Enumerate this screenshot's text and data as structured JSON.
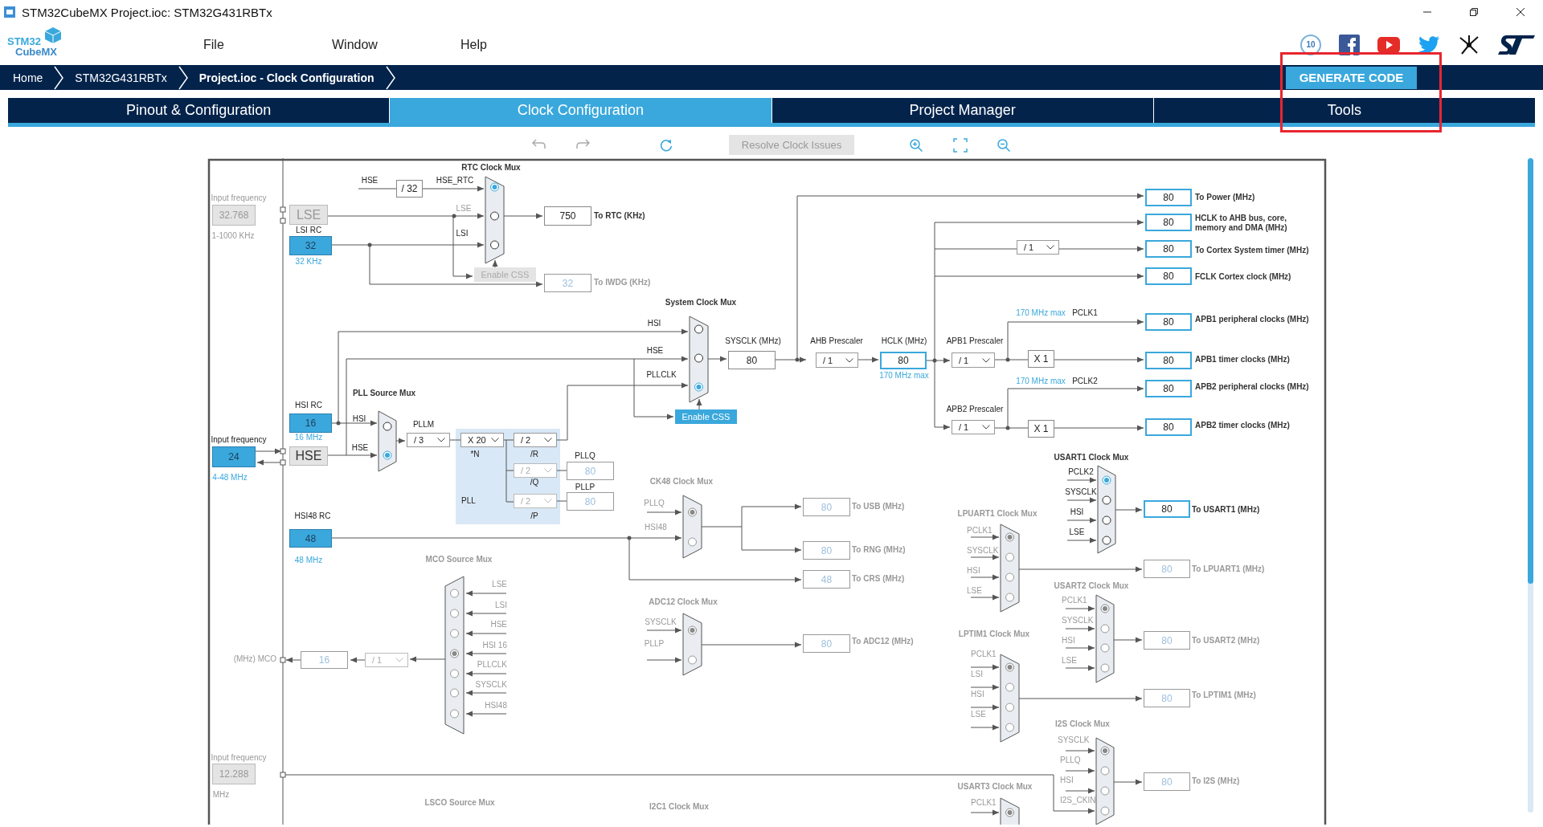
{
  "window": {
    "title": "STM32CubeMX Project.ioc: STM32G431RBTx"
  },
  "app": {
    "logo_top": "STM32",
    "logo_bottom": "CubeMX",
    "menu": [
      "File",
      "Window",
      "Help"
    ],
    "badge": "10"
  },
  "breadcrumbs": [
    {
      "label": "Home",
      "selected": false
    },
    {
      "label": "STM32G431RBTx",
      "selected": false
    },
    {
      "label": "Project.ioc - Clock Configuration",
      "selected": true
    }
  ],
  "generate_button": "GENERATE CODE",
  "tabs": [
    {
      "label": "Pinout & Configuration",
      "selected": false
    },
    {
      "label": "Clock Configuration",
      "selected": true
    },
    {
      "label": "Project Manager",
      "selected": false
    },
    {
      "label": "Tools",
      "selected": false
    }
  ],
  "toolbar": {
    "resolve_button": {
      "label": "Resolve Clock Issues",
      "disabled": true
    }
  },
  "diagram": {
    "labels": [
      {
        "text": "RTC Clock Mux",
        "kind": "title"
      },
      {
        "text": "HSE",
        "kind": "dark"
      },
      {
        "text": "HSE_RTC",
        "kind": "dark"
      },
      {
        "text": "Input frequency",
        "kind": "grey"
      },
      {
        "text": "1-1000 KHz",
        "kind": "grey"
      },
      {
        "text": "LSE",
        "kind": "grey"
      },
      {
        "text": "LSI RC",
        "kind": "dark"
      },
      {
        "text": "LSI",
        "kind": "dark"
      },
      {
        "text": "32 KHz",
        "kind": "blue"
      },
      {
        "text": "To RTC (KHz)",
        "kind": "out"
      },
      {
        "text": "To IWDG (KHz)",
        "kind": "gout"
      },
      {
        "text": "System Clock Mux",
        "kind": "title"
      },
      {
        "text": "HSI",
        "kind": "dark"
      },
      {
        "text": "HSE",
        "kind": "dark"
      },
      {
        "text": "PLLCLK",
        "kind": "dark"
      },
      {
        "text": "SYSCLK (MHz)",
        "kind": "dark"
      },
      {
        "text": "AHB Prescaler",
        "kind": "dark"
      },
      {
        "text": "HCLK (MHz)",
        "kind": "dark"
      },
      {
        "text": "170 MHz max",
        "kind": "blue"
      },
      {
        "text": "APB1 Prescaler",
        "kind": "dark"
      },
      {
        "text": "170 MHz max",
        "kind": "blue"
      },
      {
        "text": "PCLK1",
        "kind": "dark"
      },
      {
        "text": "170 MHz max",
        "kind": "blue"
      },
      {
        "text": "PCLK2",
        "kind": "dark"
      },
      {
        "text": "APB2 Prescaler",
        "kind": "dark"
      },
      {
        "text": "To Power (MHz)",
        "kind": "out"
      },
      {
        "text": "HCLK to AHB bus, core, memory and DMA (MHz)",
        "kind": "out"
      },
      {
        "text": "To Cortex System timer (MHz)",
        "kind": "out"
      },
      {
        "text": "FCLK Cortex clock (MHz)",
        "kind": "out"
      },
      {
        "text": "APB1 peripheral clocks (MHz)",
        "kind": "out"
      },
      {
        "text": "APB1 timer clocks (MHz)",
        "kind": "out"
      },
      {
        "text": "APB2 peripheral clocks (MHz)",
        "kind": "out"
      },
      {
        "text": "APB2 timer clocks (MHz)",
        "kind": "out"
      },
      {
        "text": "PLL Source Mux",
        "kind": "title"
      },
      {
        "text": "HSI RC",
        "kind": "dark"
      },
      {
        "text": "16 MHz",
        "kind": "blue"
      },
      {
        "text": "HSI",
        "kind": "dark"
      },
      {
        "text": "HSE",
        "kind": "dark"
      },
      {
        "text": "Input frequency",
        "kind": "dark"
      },
      {
        "text": "4-48 MHz",
        "kind": "blue"
      },
      {
        "text": "PLLM",
        "kind": "dark"
      },
      {
        "text": "*N",
        "kind": "dark"
      },
      {
        "text": "/R",
        "kind": "dark"
      },
      {
        "text": "PLLQ",
        "kind": "dark"
      },
      {
        "text": "/Q",
        "kind": "dark"
      },
      {
        "text": "PLLP",
        "kind": "dark"
      },
      {
        "text": "PLL",
        "kind": "dark"
      },
      {
        "text": "HSI48 RC",
        "kind": "dark"
      },
      {
        "text": "/P",
        "kind": "dark"
      },
      {
        "text": "48 MHz",
        "kind": "blue"
      },
      {
        "text": "CK48 Clock Mux",
        "kind": "mtitle"
      },
      {
        "text": "PLLQ",
        "kind": "grey"
      },
      {
        "text": "HSI48",
        "kind": "grey"
      },
      {
        "text": "To USB (MHz)",
        "kind": "gout"
      },
      {
        "text": "To RNG (MHz)",
        "kind": "gout"
      },
      {
        "text": "To CRS (MHz)",
        "kind": "gout"
      },
      {
        "text": "MCO Source Mux",
        "kind": "mtitle"
      },
      {
        "text": "LSE",
        "kind": "grey"
      },
      {
        "text": "LSI",
        "kind": "grey"
      },
      {
        "text": "HSE",
        "kind": "grey"
      },
      {
        "text": "HSI 16",
        "kind": "grey"
      },
      {
        "text": "PLLCLK",
        "kind": "grey"
      },
      {
        "text": "SYSCLK",
        "kind": "grey"
      },
      {
        "text": "HSI48",
        "kind": "grey"
      },
      {
        "text": "(MHz) MCO",
        "kind": "grey"
      },
      {
        "text": "ADC12 Clock Mux",
        "kind": "mtitle"
      },
      {
        "text": "SYSCLK",
        "kind": "grey"
      },
      {
        "text": "PLLP",
        "kind": "grey"
      },
      {
        "text": "To ADC12 (MHz)",
        "kind": "gout"
      },
      {
        "text": "Input frequency",
        "kind": "grey"
      },
      {
        "text": "MHz",
        "kind": "grey"
      },
      {
        "text": "LSCO Source Mux",
        "kind": "mtitle"
      },
      {
        "text": "I2C1 Clock Mux",
        "kind": "mtitle"
      },
      {
        "text": "USART1 Clock Mux",
        "kind": "title"
      },
      {
        "text": "PCLK2",
        "kind": "dark"
      },
      {
        "text": "SYSCLK",
        "kind": "dark"
      },
      {
        "text": "HSI",
        "kind": "dark"
      },
      {
        "text": "LSE",
        "kind": "dark"
      },
      {
        "text": "LPUART1 Clock Mux",
        "kind": "mtitle"
      },
      {
        "text": "To USART1 (MHz)",
        "kind": "out"
      },
      {
        "text": "PCLK1",
        "kind": "grey"
      },
      {
        "text": "SYSCLK",
        "kind": "grey"
      },
      {
        "text": "HSI",
        "kind": "grey"
      },
      {
        "text": "LSE",
        "kind": "grey"
      },
      {
        "text": "To LPUART1 (MHz)",
        "kind": "gout"
      },
      {
        "text": "USART2 Clock Mux",
        "kind": "mtitle"
      },
      {
        "text": "PCLK1",
        "kind": "grey"
      },
      {
        "text": "SYSCLK",
        "kind": "grey"
      },
      {
        "text": "HSI",
        "kind": "grey"
      },
      {
        "text": "LSE",
        "kind": "grey"
      },
      {
        "text": "To USART2 (MHz)",
        "kind": "gout"
      },
      {
        "text": "LPTIM1 Clock Mux",
        "kind": "mtitle"
      },
      {
        "text": "PCLK1",
        "kind": "grey"
      },
      {
        "text": "LSI",
        "kind": "grey"
      },
      {
        "text": "HSI",
        "kind": "grey"
      },
      {
        "text": "LSE",
        "kind": "grey"
      },
      {
        "text": "To LPTIM1 (MHz)",
        "kind": "gout"
      },
      {
        "text": "I2S Clock Mux",
        "kind": "mtitle"
      },
      {
        "text": "SYSCLK",
        "kind": "grey"
      },
      {
        "text": "PLLQ",
        "kind": "grey"
      },
      {
        "text": "HSI",
        "kind": "grey"
      },
      {
        "text": "I2S_CKIN",
        "kind": "grey"
      },
      {
        "text": "To I2S (MHz)",
        "kind": "gout"
      },
      {
        "text": "USART3 Clock Mux",
        "kind": "mtitle"
      },
      {
        "text": "PCLK1",
        "kind": "grey"
      }
    ],
    "fields": [
      {
        "value": "32.768",
        "kind": "inactive"
      },
      {
        "value": "LSE",
        "kind": "source-off"
      },
      {
        "value": "32",
        "kind": "input"
      },
      {
        "value": "/ 32",
        "kind": "plain"
      },
      {
        "value": "750",
        "kind": "plain"
      },
      {
        "value": "32",
        "kind": "disabled"
      },
      {
        "value": "80",
        "kind": "plain"
      },
      {
        "value": "16",
        "kind": "input"
      },
      {
        "value": "24",
        "kind": "input"
      },
      {
        "value": "HSE",
        "kind": "source"
      },
      {
        "value": "80",
        "kind": "disabled"
      },
      {
        "value": "80",
        "kind": "disabled"
      },
      {
        "value": "48",
        "kind": "input"
      },
      {
        "value": "16",
        "kind": "disabled"
      },
      {
        "value": "12.288",
        "kind": "inactive"
      },
      {
        "value": "80",
        "kind": "output"
      },
      {
        "value": "X 1",
        "kind": "plain"
      },
      {
        "value": "X 1",
        "kind": "plain"
      },
      {
        "value": "80",
        "kind": "output"
      },
      {
        "value": "80",
        "kind": "output"
      },
      {
        "value": "80",
        "kind": "output"
      },
      {
        "value": "80",
        "kind": "output"
      },
      {
        "value": "80",
        "kind": "output"
      },
      {
        "value": "80",
        "kind": "output"
      },
      {
        "value": "80",
        "kind": "output"
      },
      {
        "value": "80",
        "kind": "output"
      },
      {
        "value": "80",
        "kind": "output"
      },
      {
        "value": "80",
        "kind": "disabled"
      },
      {
        "value": "80",
        "kind": "disabled"
      },
      {
        "value": "48",
        "kind": "disabled"
      },
      {
        "value": "80",
        "kind": "disabled"
      },
      {
        "value": "80",
        "kind": "disabled"
      },
      {
        "value": "80",
        "kind": "disabled"
      },
      {
        "value": "80",
        "kind": "disabled"
      },
      {
        "value": "80",
        "kind": "disabled"
      }
    ],
    "dropdowns": [
      {
        "value": "/ 3",
        "disabled": false
      },
      {
        "value": "X 20",
        "disabled": false
      },
      {
        "value": "/ 2",
        "disabled": false
      },
      {
        "value": "/ 2",
        "disabled": true
      },
      {
        "value": "/ 2",
        "disabled": true
      },
      {
        "value": "/ 1",
        "disabled": true
      },
      {
        "value": "/ 1",
        "disabled": false
      },
      {
        "value": "/ 1",
        "disabled": false
      },
      {
        "value": "/ 1",
        "disabled": false
      },
      {
        "value": "/ 1",
        "disabled": false
      }
    ],
    "muxes": [
      {
        "enabled": true,
        "options": [
          {
            "selected": true
          },
          {
            "selected": false
          },
          {
            "selected": false
          }
        ]
      },
      {
        "enabled": true,
        "options": [
          {
            "selected": false
          },
          {
            "selected": false
          },
          {
            "selected": true
          }
        ]
      },
      {
        "enabled": true,
        "options": [
          {
            "selected": false
          },
          {
            "selected": true
          }
        ]
      },
      {
        "enabled": false,
        "options": [
          {
            "selected": true
          },
          {
            "selected": false
          }
        ]
      },
      {
        "enabled": false,
        "options": [
          {
            "selected": false
          },
          {
            "selected": false
          },
          {
            "selected": false
          },
          {
            "selected": true
          },
          {
            "selected": false
          },
          {
            "selected": false
          },
          {
            "selected": false
          }
        ]
      },
      {
        "enabled": false,
        "options": [
          {
            "selected": true
          },
          {
            "selected": false
          }
        ]
      },
      {
        "enabled": true,
        "options": [
          {
            "selected": true
          },
          {
            "selected": false
          },
          {
            "selected": false
          },
          {
            "selected": false
          }
        ]
      },
      {
        "enabled": false,
        "options": [
          {
            "selected": true
          },
          {
            "selected": false
          },
          {
            "selected": false
          },
          {
            "selected": false
          }
        ]
      },
      {
        "enabled": false,
        "options": [
          {
            "selected": true
          },
          {
            "selected": false
          },
          {
            "selected": false
          },
          {
            "selected": false
          }
        ]
      },
      {
        "enabled": false,
        "options": [
          {
            "selected": true
          },
          {
            "selected": false
          },
          {
            "selected": false
          },
          {
            "selected": false
          }
        ]
      },
      {
        "enabled": false,
        "options": [
          {
            "selected": true
          },
          {
            "selected": false
          },
          {
            "selected": false
          },
          {
            "selected": false
          }
        ]
      },
      {
        "enabled": false,
        "options": [
          {
            "selected": true
          }
        ]
      }
    ],
    "buttons": [
      {
        "label": "Enable CSS",
        "enabled": false
      },
      {
        "label": "Enable CSS",
        "enabled": true
      }
    ]
  }
}
